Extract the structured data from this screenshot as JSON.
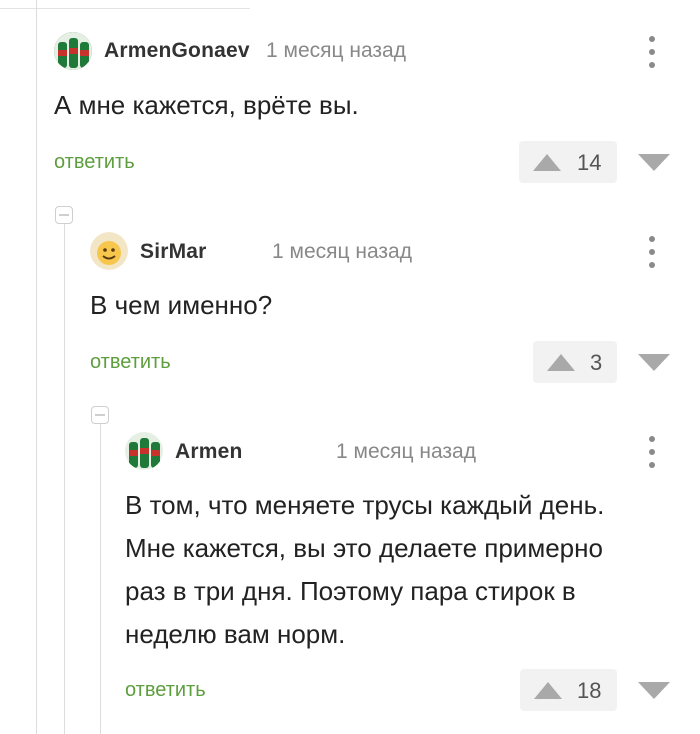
{
  "comments": [
    {
      "username": "ArmenGonaev",
      "time": "1 месяц назад",
      "text": "А мне кажется, врёте вы.",
      "reply_label": "ответить",
      "rating": "14",
      "avatar_icon": "bottle-avatar-icon"
    },
    {
      "username": "SirMar",
      "time": "1 месяц назад",
      "text": "В чем именно?",
      "reply_label": "ответить",
      "rating": "3",
      "avatar_icon": "smiley-avatar-icon"
    },
    {
      "username": "Armen",
      "time": "1 месяц назад",
      "text_lines": [
        "В том, что меняете трусы каждый день.",
        "Мне кажется, вы это делаете примерно",
        "раз в три дня. Поэтому пара стирок в",
        "неделю вам норм."
      ],
      "reply_label": "ответить",
      "rating": "18",
      "avatar_icon": "bottle-avatar-icon"
    }
  ],
  "colors": {
    "reply": "#5d9e3e",
    "arrow": "#a9a9a9",
    "vote_bg": "#f2f2f2",
    "thread_line": "#dcdcdc"
  }
}
